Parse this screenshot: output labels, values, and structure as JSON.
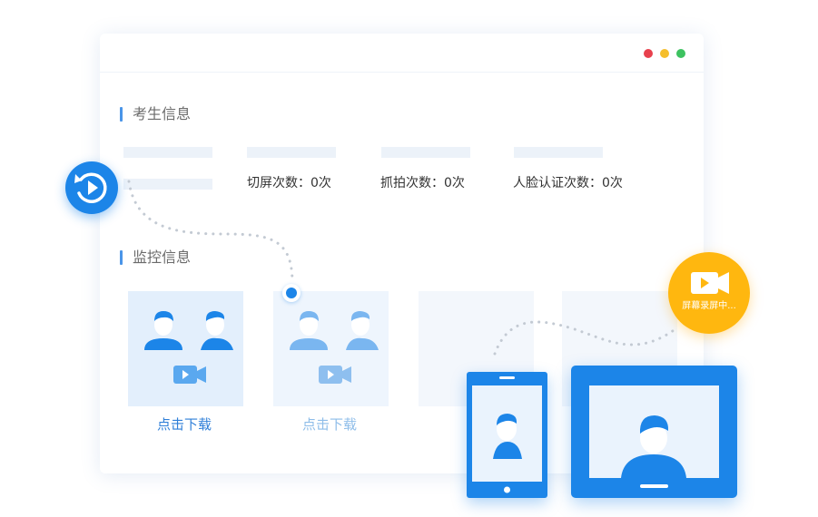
{
  "colors": {
    "accent": "#1c85e8",
    "record_badge": "#ffb70f",
    "dot_red": "#e8414d",
    "dot_yellow": "#f5be2c",
    "dot_green": "#3dc260"
  },
  "candidate_info": {
    "title": "考生信息",
    "stats": {
      "screen_switch": "切屏次数：0次",
      "capture": "抓拍次数：0次",
      "face_verify": "人脸认证次数：0次"
    }
  },
  "monitor_info": {
    "title": "监控信息",
    "download_1": "点击下载",
    "download_2": "点击下载"
  },
  "recording_badge": {
    "text": "屏幕录屏中...",
    "icon": "video-camera-icon"
  },
  "replay_button": {
    "icon": "replay-icon"
  }
}
